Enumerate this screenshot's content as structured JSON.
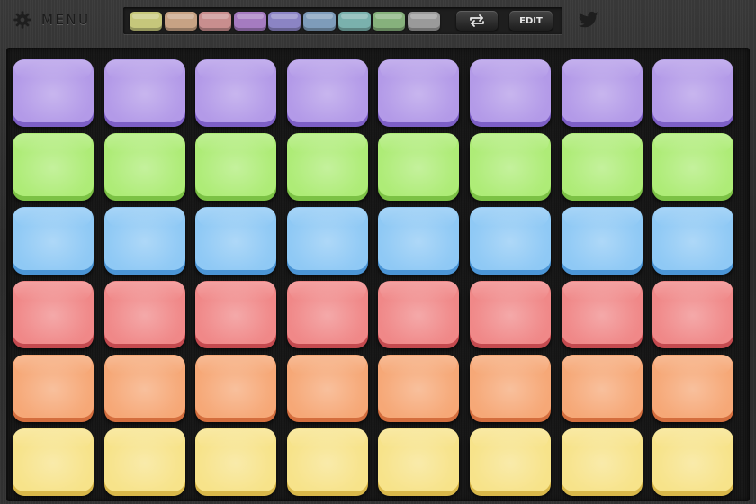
{
  "header": {
    "menu_label": "MENU",
    "menu_icon": "gear-icon",
    "swap_icon": "swap-arrows-icon",
    "edit_label": "EDIT",
    "twitter_icon": "twitter-bird-icon"
  },
  "swatches": [
    {
      "name": "yellow-green",
      "color": "#c6c77b"
    },
    {
      "name": "tan",
      "color": "#c7a284"
    },
    {
      "name": "pink",
      "color": "#c98e8e"
    },
    {
      "name": "purple",
      "color": "#a57bc0"
    },
    {
      "name": "violet",
      "color": "#8b84c4"
    },
    {
      "name": "steel-blue",
      "color": "#7e9cba"
    },
    {
      "name": "teal",
      "color": "#7ab1ad"
    },
    {
      "name": "green",
      "color": "#86b17c"
    },
    {
      "name": "gray",
      "color": "#9a9a9a"
    }
  ],
  "pad_rows": [
    {
      "color": "#b39ae8",
      "dark": "#7d5fc6",
      "pads": 8
    },
    {
      "color": "#aeec77",
      "dark": "#7cc245",
      "pads": 8
    },
    {
      "color": "#8fc9f5",
      "dark": "#4b95d6",
      "pads": 8
    },
    {
      "color": "#f08888",
      "dark": "#c44a4f",
      "pads": 8
    },
    {
      "color": "#f6a877",
      "dark": "#d46e3e",
      "pads": 8
    },
    {
      "color": "#f7e38a",
      "dark": "#d9b84a",
      "pads": 8
    }
  ]
}
